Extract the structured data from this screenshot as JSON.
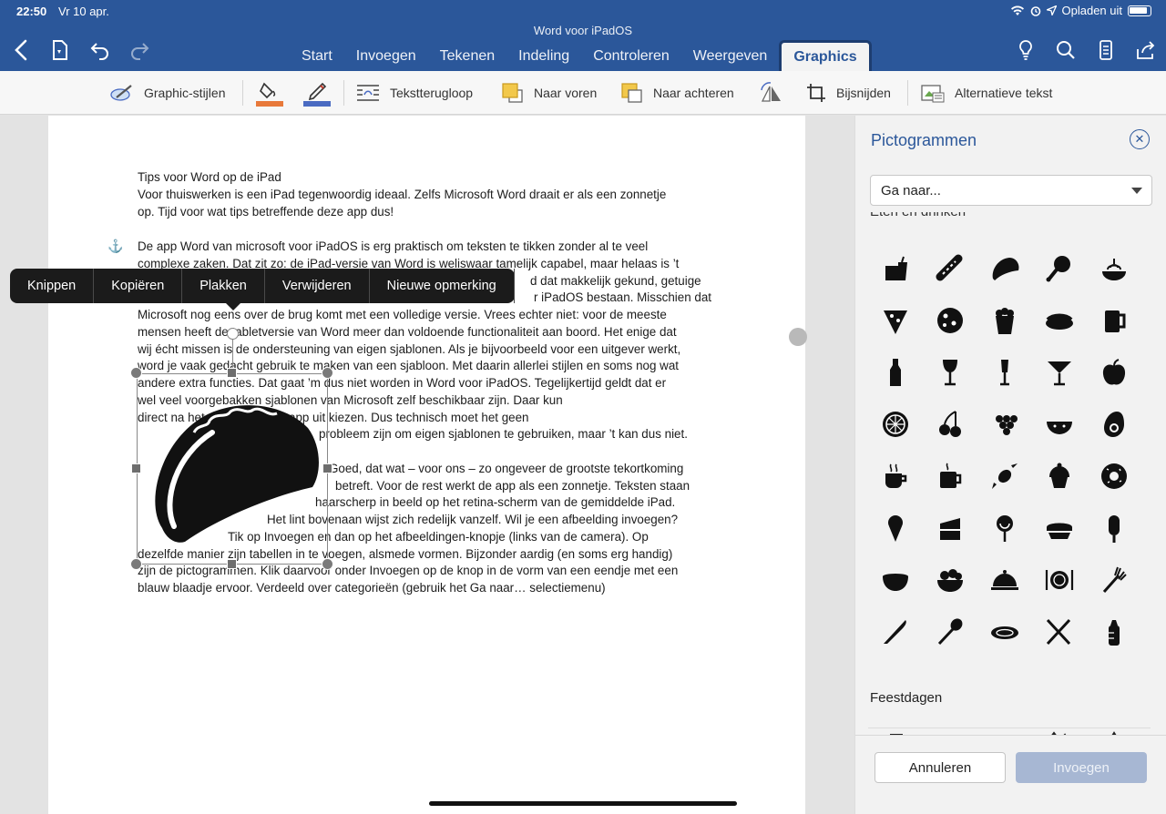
{
  "status": {
    "time": "22:50",
    "date": "Vr 10 apr.",
    "charging": "Opladen uit"
  },
  "app": {
    "title": "Word voor iPadOS"
  },
  "tabs": [
    "Start",
    "Invoegen",
    "Tekenen",
    "Indeling",
    "Controleren",
    "Weergeven",
    "Graphics"
  ],
  "active_tab": "Graphics",
  "ribbon": {
    "styles": "Graphic-stijlen",
    "wrap": "Tekstterugloop",
    "forward": "Naar voren",
    "backward": "Naar achteren",
    "crop": "Bijsnijden",
    "alt": "Alternatieve tekst",
    "fill_color": "#e8793a",
    "line_color": "#4a6bc2"
  },
  "document": {
    "lines": [
      "Tips voor Word op de iPad",
      "Voor thuiswerken is een iPad tegenwoordig ideaal. Zelfs Microsoft Word draait er als een zonnetje",
      "op. Tijd voor wat tips betreffende deze app dus!",
      "",
      "De app Word van microsoft voor iPadOS is erg praktisch om teksten te tikken zonder al te veel",
      "complexe zaken. Dat zit zo: de iPad-versie van Word is weliswaar tamelijk capabel, maar helaas is ’t",
      "d dat makkelijk gekund, getuige",
      "r iPadOS bestaan. Misschien dat",
      "Microsoft nog eens over de brug komt met een volledige versie. Vrees echter niet: voor de meeste",
      "mensen heeft de tabletversie van Word meer dan voldoende functionaliteit aan boord. Het enige dat",
      "wij écht missen is de ondersteuning van eigen sjablonen. Als je bijvoorbeeld voor een uitgever werkt,",
      "word je vaak gedacht gebruik te maken van een sjabloon. Met daarin allerlei stijlen en soms nog wat",
      "andere extra functies. Dat gaat ’m dus niet worden in Word voor iPadOS. Tegelijkertijd geldt dat er",
      "wel veel voorgebakken sjablonen van Microsoft zelf beschikbaar zijn. Daar kun",
      "direct na het starten van de app uit kiezen. Dus technisch moet het geen",
      "probleem zijn om eigen sjablonen te gebruiken, maar ’t kan dus niet.",
      "",
      "Goed, dat wat – voor ons – zo ongeveer de grootste tekortkoming",
      "betreft. Voor de rest werkt de app als een zonnetje. Teksten staan",
      "haarscherp in beeld op het retina-scherm van de gemiddelde iPad.",
      "Het lint bovenaan wijst zich redelijk vanzelf. Wil je een afbeelding invoegen?",
      "Tik op Invoegen en dan op het afbeeldingen-knopje (links van de camera). Op",
      "dezelfde manier zijn tabellen in te voegen, alsmede vormen. Bijzonder aardig (en soms erg handig)",
      "zijn de pictogrammen. Klik daarvoor onder Invoegen op de knop in de vorm van een eendje met een",
      "blauw blaadje ervoor. Verdeeld over categorieën (gebruik het Ga naar… selectiemenu)"
    ]
  },
  "context_menu": [
    "Knippen",
    "Kopiëren",
    "Plakken",
    "Verwijderen",
    "Nieuwe opmerking"
  ],
  "pane": {
    "title": "Pictogrammen",
    "goto": "Ga naar...",
    "category_cut": "Eten en drinken",
    "category_next": "Feestdagen",
    "cancel": "Annuleren",
    "insert": "Invoegen",
    "icons": [
      "fastfood-icon",
      "hotdog-icon",
      "taco-icon",
      "drumstick-icon",
      "spaghetti-icon",
      "pizza-slice-icon",
      "pizza-icon",
      "popcorn-icon",
      "sushi-icon",
      "beer-mug-icon",
      "bottle-icon",
      "wine-glass-icon",
      "champagne-icon",
      "cocktail-icon",
      "apple-icon",
      "citrus-icon",
      "cherries-icon",
      "grapes-icon",
      "watermelon-icon",
      "avocado-icon",
      "coffee-cup-icon",
      "mug-icon",
      "candy-icon",
      "cupcake-icon",
      "donut-icon",
      "ice-cream-icon",
      "cake-slice-icon",
      "lollipop-icon",
      "pie-icon",
      "popsicle-icon",
      "bowl-icon",
      "fruit-bowl-icon",
      "cloche-icon",
      "plate-cutlery-icon",
      "fork-icon",
      "knife-icon",
      "spoon-icon",
      "plate-icon",
      "crossed-cutlery-icon",
      "baby-bottle-icon"
    ]
  }
}
